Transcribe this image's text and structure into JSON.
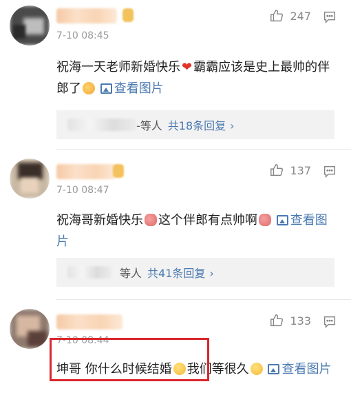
{
  "comments": [
    {
      "time": "7-10 08:45",
      "likes": "247",
      "text_parts": [
        "祝海一天老师新婚快乐",
        "霸霸应该是史上最帅的伴郎了"
      ],
      "view_image": "查看图片",
      "reply_suffix": "-等人",
      "reply_count": "共18条回复",
      "emojis": [
        "heart",
        "laugh"
      ]
    },
    {
      "time": "7-10 08:47",
      "likes": "137",
      "text_parts": [
        "祝海哥新婚快乐",
        "这个伴郎有点帅啊"
      ],
      "view_image": "查看图片",
      "reply_suffix": "等人",
      "reply_count": "共41条回复",
      "emojis": [
        "pig",
        "pig"
      ]
    },
    {
      "time": "7-10 08:44",
      "likes": "133",
      "text_parts": [
        "坤哥 你什么时候结婚",
        "我们等很久"
      ],
      "view_image": "查看图片",
      "emojis": [
        "drop",
        "drop"
      ]
    }
  ],
  "icons": {
    "like": "thumb-up-icon",
    "more": "more-options-icon",
    "image": "image-icon",
    "chevron": "chevron-right-icon"
  },
  "colors": {
    "link": "#4a79b0",
    "highlight_border": "#d9252b",
    "reply_bg": "#f2f2f2"
  },
  "chevron_glyph": "›"
}
